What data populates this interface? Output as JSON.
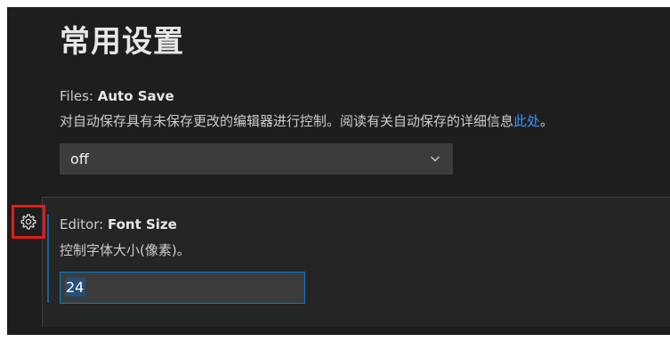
{
  "section": {
    "title": "常用设置"
  },
  "auto_save": {
    "category": "Files: ",
    "name": "Auto Save",
    "description": "对自动保存具有未保存更改的编辑器进行控制。阅读有关自动保存的详细信息",
    "link_text": "此处",
    "description_end": "。",
    "value": "off",
    "chevron_icon": "chevron-down-icon"
  },
  "font_size": {
    "category": "Editor: ",
    "name": "Font Size",
    "description": "控制字体大小(像素)。",
    "value": "24",
    "gear_icon": "gear-icon"
  },
  "colors": {
    "background": "#1e1e1e",
    "focused_row": "#252526",
    "link": "#3794ff",
    "focus_border": "#007fd4",
    "highlight_box": "#e41b1b"
  }
}
